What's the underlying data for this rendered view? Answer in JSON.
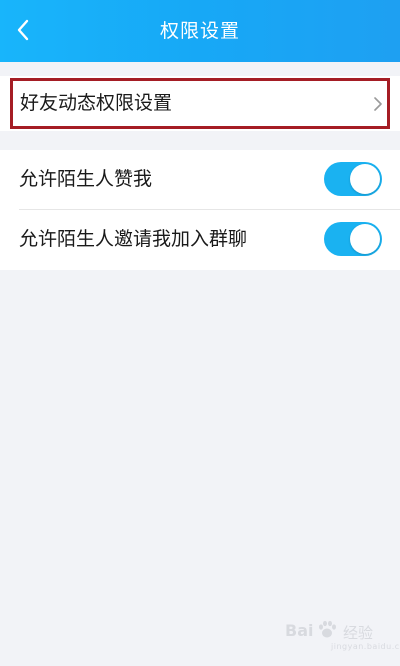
{
  "header": {
    "title": "权限设置",
    "back_icon": "chevron-left-icon",
    "background": "#18b5fb"
  },
  "friend_settings": {
    "label": "好友动态权限设置",
    "chevron_icon": "chevron-right-icon",
    "highlight_color": "#a51d24"
  },
  "toggles": [
    {
      "label": "允许陌生人赞我",
      "on": true
    },
    {
      "label": "允许陌生人邀请我加入群聊",
      "on": true
    }
  ],
  "toggle_color": "#1ab2f1",
  "watermark": {
    "brand": "Bai",
    "brand_cn": "经验",
    "url": "jingyan.baidu.com"
  }
}
